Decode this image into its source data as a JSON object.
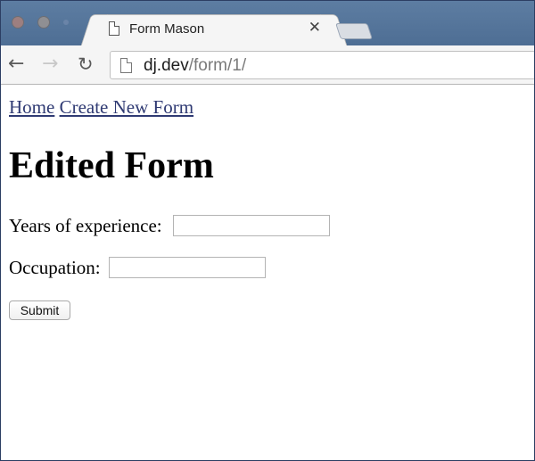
{
  "browser": {
    "tab_title": "Form Mason",
    "tab_close_glyph": "✕",
    "url_host": "dj.dev",
    "url_path": "/form/1/",
    "icons": {
      "back": "back-arrow-icon",
      "forward": "forward-arrow-icon",
      "reload": "reload-icon",
      "page": "page-icon",
      "close": "close-icon"
    }
  },
  "nav": {
    "home_label": "Home",
    "create_label": "Create New Form"
  },
  "page": {
    "title": "Edited Form",
    "fields": [
      {
        "label": "Years of experience:",
        "value": ""
      },
      {
        "label": "Occupation:",
        "value": ""
      }
    ],
    "submit_label": "Submit"
  },
  "colors": {
    "tabstrip": "#5d7da2",
    "link": "#2f3a73"
  }
}
